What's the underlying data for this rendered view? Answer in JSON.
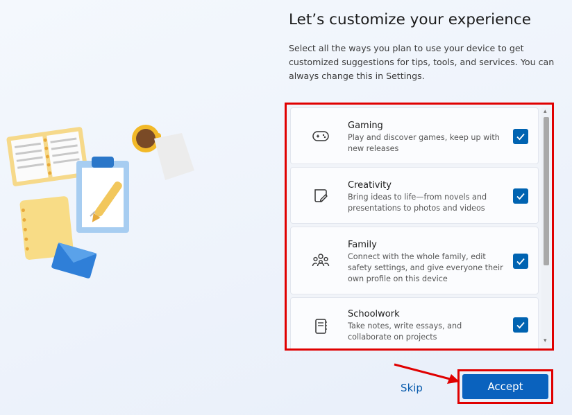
{
  "header": {
    "title": "Let’s customize your experience",
    "description": "Select all the ways you plan to use your device to get customized suggestions for tips, tools, and services. You can always change this in Settings."
  },
  "options": [
    {
      "title": "Gaming",
      "description": "Play and discover games, keep up with new releases",
      "icon": "gamepad-icon",
      "checked": true
    },
    {
      "title": "Creativity",
      "description": "Bring ideas to life—from novels and presentations to photos and videos",
      "icon": "sticky-note-pen-icon",
      "checked": true
    },
    {
      "title": "Family",
      "description": "Connect with the whole family, edit safety settings, and give everyone their own profile on this device",
      "icon": "people-group-icon",
      "checked": true
    },
    {
      "title": "Schoolwork",
      "description": "Take notes, write essays, and collaborate on projects",
      "icon": "notebook-icon",
      "checked": true
    }
  ],
  "footer": {
    "skip_label": "Skip",
    "accept_label": "Accept"
  },
  "colors": {
    "accent": "#0063b1",
    "highlight_border": "#e00000",
    "link": "#0a5cad"
  }
}
